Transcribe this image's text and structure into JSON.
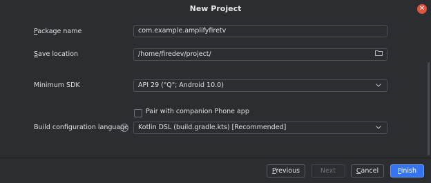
{
  "window": {
    "title": "New Project"
  },
  "form": {
    "package_name": {
      "label_mnemonic": "P",
      "label_rest": "ackage name",
      "value": "com.example.amplifyfiretv"
    },
    "save_location": {
      "label_mnemonic": "S",
      "label_rest": "ave location",
      "value": "/home/firedev/project/",
      "icon": "folder-icon"
    },
    "minimum_sdk": {
      "label": "Minimum SDK",
      "value": "API 29 (\"Q\"; Android 10.0)"
    },
    "companion": {
      "label": "Pair with companion Phone app",
      "checked": false
    },
    "build_language": {
      "label": "Build configuration language",
      "value": "Kotlin DSL (build.gradle.kts) [Recommended]"
    }
  },
  "footer": {
    "previous": {
      "mnemonic": "P",
      "rest": "revious"
    },
    "next": {
      "label": "Next"
    },
    "cancel": {
      "mnemonic": "C",
      "rest": "ancel"
    },
    "finish": {
      "mnemonic": "F",
      "rest": "inish"
    }
  },
  "colors": {
    "accent": "#3574f0",
    "close": "#e0553d",
    "background": "#2b2d30"
  }
}
